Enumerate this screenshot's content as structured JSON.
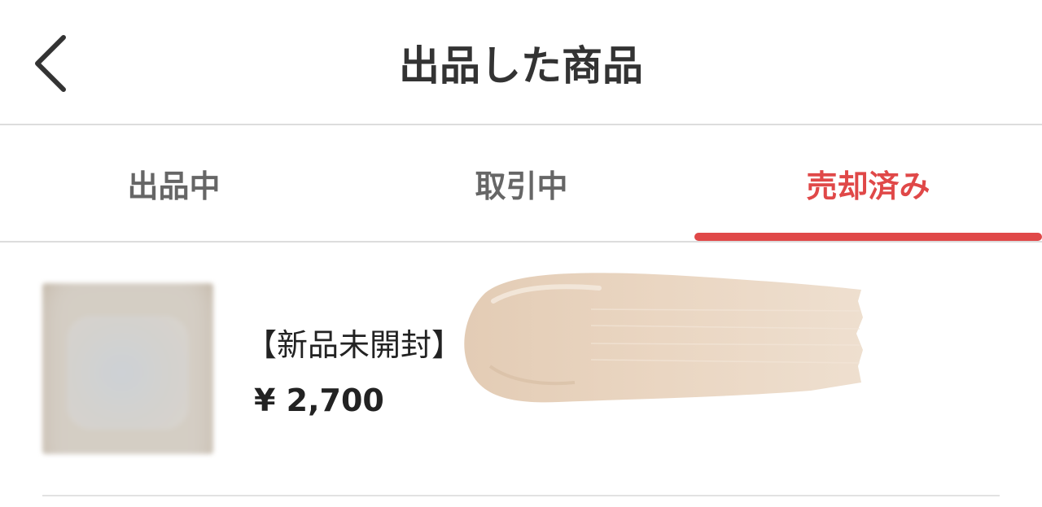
{
  "header": {
    "title": "出品した商品",
    "back_icon": "chevron-left-icon"
  },
  "tabs": [
    {
      "label": "出品中",
      "active": false
    },
    {
      "label": "取引中",
      "active": false
    },
    {
      "label": "売却済み",
      "active": true
    }
  ],
  "colors": {
    "accent": "#e04848",
    "text": "#333333",
    "tab_inactive": "#666666",
    "divider": "#dddddd"
  },
  "items": [
    {
      "title": "【新品未開封】",
      "price": "¥ 2,700"
    }
  ]
}
